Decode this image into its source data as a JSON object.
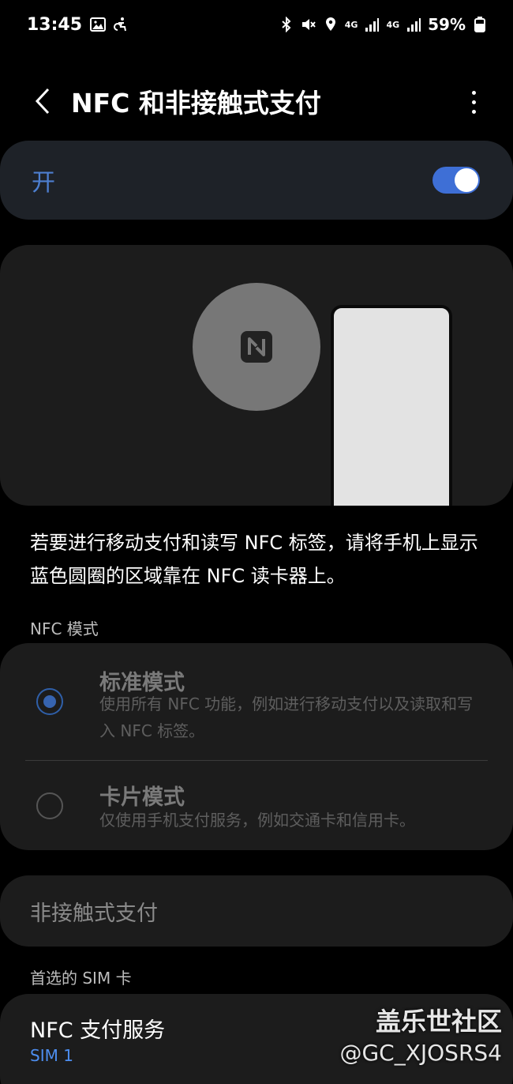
{
  "status_bar": {
    "time": "13:45",
    "battery": "59%",
    "net1": "4G",
    "net2": "4G"
  },
  "header": {
    "title": "NFC 和非接触式支付"
  },
  "nfc_switch": {
    "label": "开",
    "state": "on",
    "accent_color": "#3e6fd6"
  },
  "description": "若要进行移动支付和读写 NFC 标签，请将手机上显示蓝色圆圈的区域靠在 NFC 读卡器上。",
  "nfc_mode": {
    "section_label": "NFC 模式",
    "options": [
      {
        "title": "标准模式",
        "subtitle": "使用所有 NFC 功能，例如进行移动支付以及读取和写入 NFC 标签。",
        "selected": true
      },
      {
        "title": "卡片模式",
        "subtitle": "仅使用手机支付服务，例如交通卡和信用卡。",
        "selected": false
      }
    ]
  },
  "contactless": {
    "label": "非接触式支付"
  },
  "preferred_sim": {
    "section_label": "首选的 SIM 卡",
    "title": "NFC 支付服务",
    "value": "SIM 1"
  },
  "watermark": {
    "line1": "盖乐世社区",
    "line2": "@GC_XJOSRS4"
  }
}
